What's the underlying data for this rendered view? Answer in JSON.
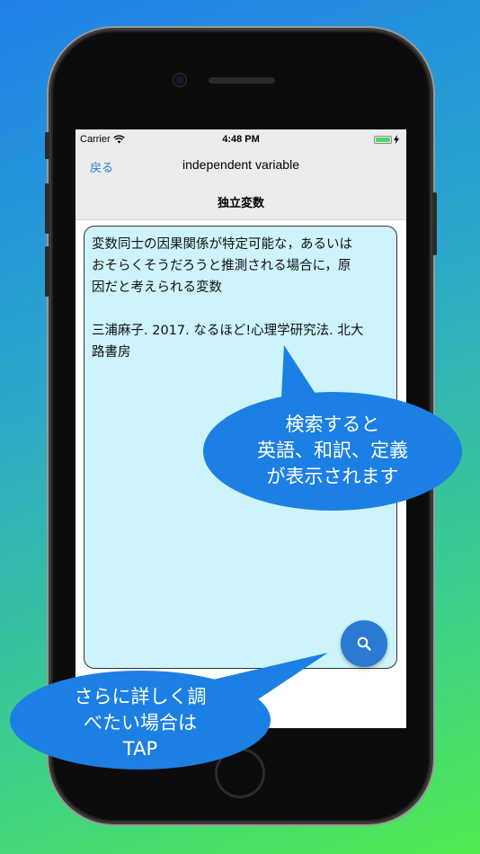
{
  "status": {
    "carrier": "Carrier",
    "time": "4:48 PM"
  },
  "nav": {
    "back_label": "戻る",
    "title": "independent variable"
  },
  "subtitle": "独立変数",
  "definition": {
    "lines": [
      "変数同士の因果関係が特定可能な，あるいは",
      "おそらくそうだろうと推測される場合に，原",
      "因だと考えられる変数"
    ],
    "citation_lines": [
      "三浦麻子. 2017. なるほど!心理学研究法. 北大",
      "路書房"
    ]
  },
  "bubbles": {
    "top_lines": [
      "検索すると",
      "英語、和訳、定義",
      "が表示されます"
    ],
    "bottom_lines": [
      "さらに詳しく調",
      "べたい場合は",
      "TAP"
    ]
  },
  "colors": {
    "accent": "#2f7ad6",
    "bubble": "#1c7fe3",
    "textbox_bg": "#cdf3fb",
    "search_button": "#2a79d3"
  },
  "icons": {
    "search": "magnifier-icon",
    "wifi": "wifi-icon",
    "battery": "battery-icon"
  }
}
